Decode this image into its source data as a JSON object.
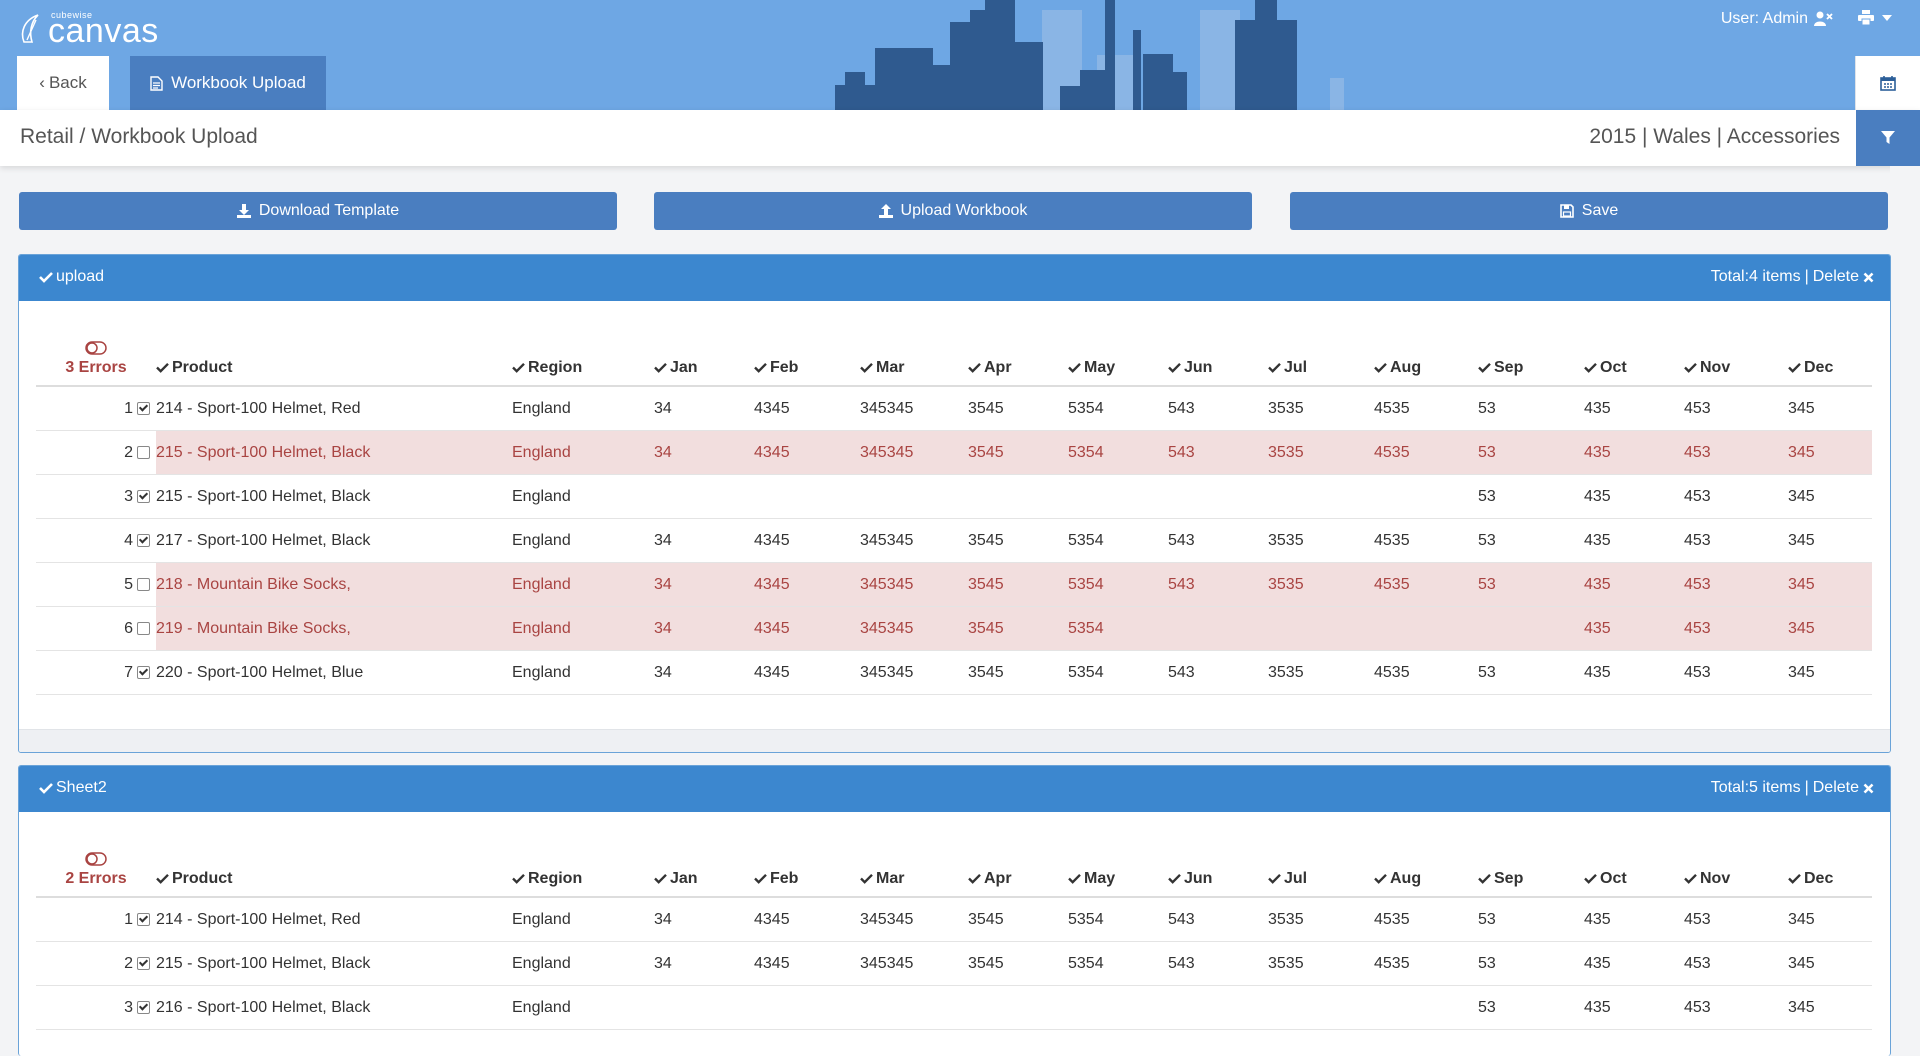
{
  "header": {
    "logo_small": "cubewise",
    "logo_main": "canvas",
    "user_label": "User: Admin",
    "user_icon": "user-times-icon",
    "print_icon": "print-icon",
    "caret_icon": "caret-down-icon",
    "back_label": "Back",
    "active_tab_label": "Workbook Upload",
    "calendar_icon": "calendar-icon",
    "brand_color": "#6ea7e4",
    "accent_color": "#4a7ec0"
  },
  "subbar": {
    "breadcrumb": "Retail / Workbook Upload",
    "context": "2015 | Wales | Accessories",
    "filter_icon": "filter-icon"
  },
  "actions": {
    "download_label": "Download Template",
    "upload_label": "Upload Workbook",
    "save_label": "Save"
  },
  "columns": [
    "Product",
    "Region",
    "Jan",
    "Feb",
    "Mar",
    "Apr",
    "May",
    "Jun",
    "Jul",
    "Aug",
    "Sep",
    "Oct",
    "Nov",
    "Dec"
  ],
  "panels": [
    {
      "title": "upload",
      "total": "Total:4 items",
      "separator": "|",
      "delete": "Delete",
      "errors": "3 Errors",
      "rows": [
        {
          "n": "1",
          "checked": true,
          "error": false,
          "cells": [
            "214 - Sport-100 Helmet, Red",
            "England",
            "34",
            "4345",
            "345345",
            "3545",
            "5354",
            "543",
            "3535",
            "4535",
            "53",
            "435",
            "453",
            "345"
          ]
        },
        {
          "n": "2",
          "checked": false,
          "error": true,
          "cells": [
            "215 - Sport-100 Helmet, Black",
            "England",
            "34",
            "4345",
            "345345",
            "3545",
            "5354",
            "543",
            "3535",
            "4535",
            "53",
            "435",
            "453",
            "345"
          ]
        },
        {
          "n": "3",
          "checked": true,
          "error": false,
          "cells": [
            "215 - Sport-100 Helmet, Black",
            "England",
            "",
            "",
            "",
            "",
            "",
            "",
            "",
            "",
            "53",
            "435",
            "453",
            "345"
          ]
        },
        {
          "n": "4",
          "checked": true,
          "error": false,
          "cells": [
            "217 - Sport-100 Helmet, Black",
            "England",
            "34",
            "4345",
            "345345",
            "3545",
            "5354",
            "543",
            "3535",
            "4535",
            "53",
            "435",
            "453",
            "345"
          ]
        },
        {
          "n": "5",
          "checked": false,
          "error": true,
          "cells": [
            "218 - Mountain Bike Socks,",
            "England",
            "34",
            "4345",
            "345345",
            "3545",
            "5354",
            "543",
            "3535",
            "4535",
            "53",
            "435",
            "453",
            "345"
          ]
        },
        {
          "n": "6",
          "checked": false,
          "error": true,
          "cells": [
            "219 - Mountain Bike Socks,",
            "England",
            "34",
            "4345",
            "345345",
            "3545",
            "5354",
            "",
            "",
            "",
            "",
            "435",
            "453",
            "345"
          ]
        },
        {
          "n": "7",
          "checked": true,
          "error": false,
          "cells": [
            "220 - Sport-100 Helmet, Blue",
            "England",
            "34",
            "4345",
            "345345",
            "3545",
            "5354",
            "543",
            "3535",
            "4535",
            "53",
            "435",
            "453",
            "345"
          ]
        }
      ]
    },
    {
      "title": "Sheet2",
      "total": "Total:5 items",
      "separator": "|",
      "delete": "Delete",
      "errors": "2 Errors",
      "rows": [
        {
          "n": "1",
          "checked": true,
          "error": false,
          "cells": [
            "214 - Sport-100 Helmet, Red",
            "England",
            "34",
            "4345",
            "345345",
            "3545",
            "5354",
            "543",
            "3535",
            "4535",
            "53",
            "435",
            "453",
            "345"
          ]
        },
        {
          "n": "2",
          "checked": true,
          "error": false,
          "cells": [
            "215 - Sport-100 Helmet, Black",
            "England",
            "34",
            "4345",
            "345345",
            "3545",
            "5354",
            "543",
            "3535",
            "4535",
            "53",
            "435",
            "453",
            "345"
          ]
        },
        {
          "n": "3",
          "checked": true,
          "error": false,
          "cells": [
            "216 - Sport-100 Helmet, Black",
            "England",
            "",
            "",
            "",
            "",
            "",
            "",
            "",
            "",
            "53",
            "435",
            "453",
            "345"
          ]
        }
      ]
    }
  ]
}
